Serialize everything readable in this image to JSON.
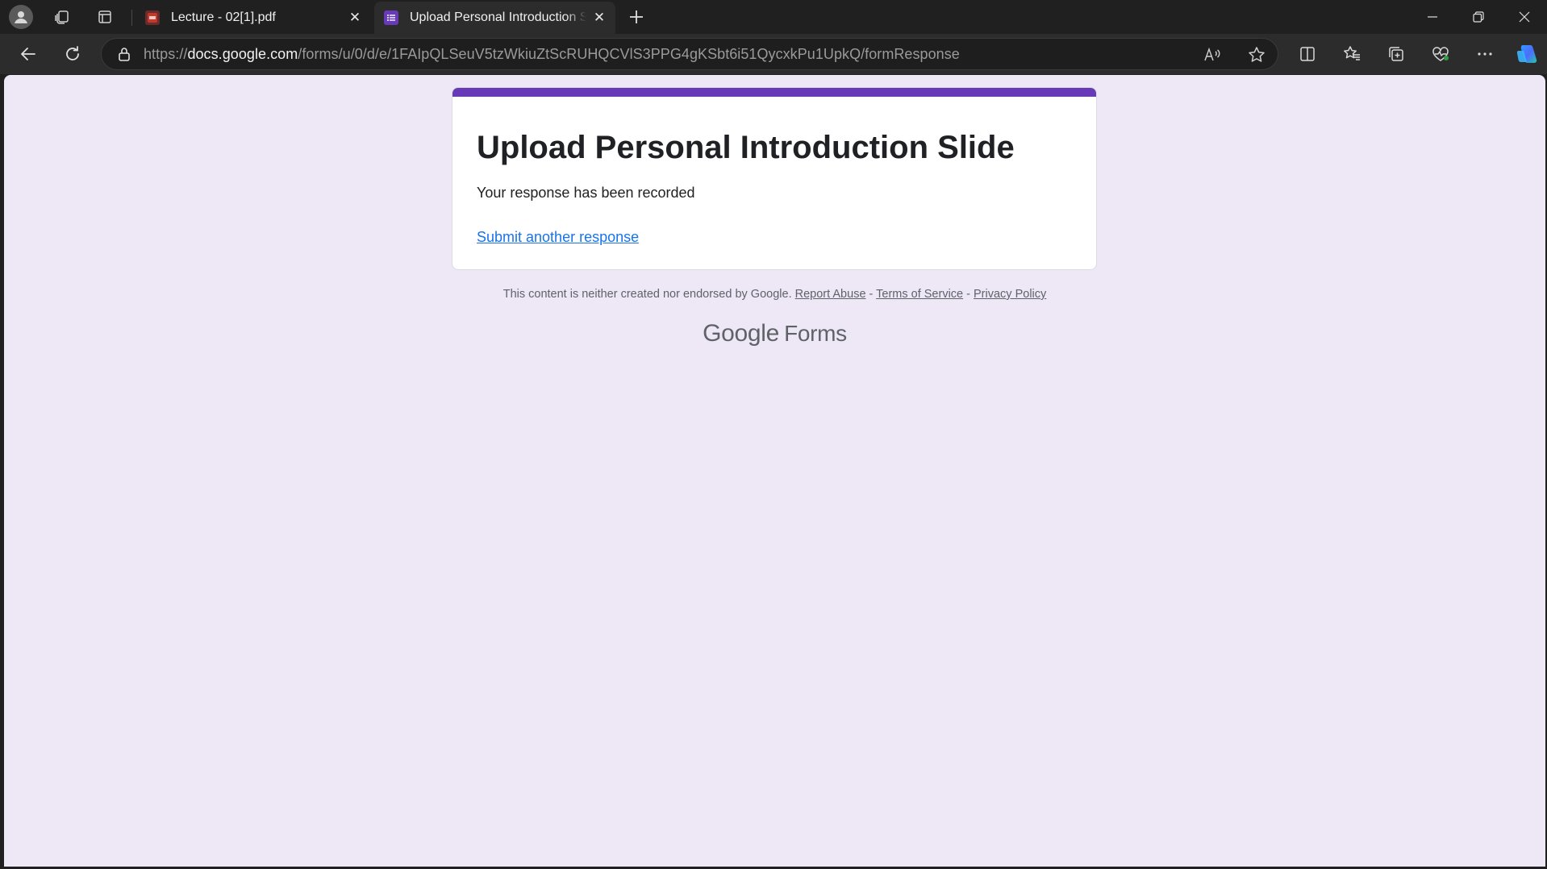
{
  "browser": {
    "tabs": [
      {
        "title": "Lecture - 02[1].pdf",
        "favicon": "pdf-icon",
        "active": false
      },
      {
        "title": "Upload Personal Introduction Slide",
        "favicon": "google-forms-icon",
        "active": true
      }
    ],
    "url_prefix": "https://",
    "url_host": "docs.google.com",
    "url_path": "/forms/u/0/d/e/1FAIpQLSeuV5tzWkiuZtScRUHQCVlS3PPG4gKSbt6i51QycxkPu1UpkQ/formResponse",
    "colors": {
      "frame": "#202020",
      "toolbar": "#2c2c2c",
      "page_bg": "#ede7f6",
      "accent": "#673ab7",
      "link": "#1a73e8"
    }
  },
  "form": {
    "title": "Upload Personal Introduction Slide",
    "confirmation": "Your response has been recorded",
    "submit_another": "Submit another response"
  },
  "footer": {
    "disclaimer": "This content is neither created nor endorsed by Google.",
    "report_abuse": "Report Abuse",
    "sep1": " - ",
    "terms": "Terms of Service",
    "sep2": " - ",
    "privacy": "Privacy Policy",
    "brand_google": "Google",
    "brand_forms": "Forms"
  }
}
